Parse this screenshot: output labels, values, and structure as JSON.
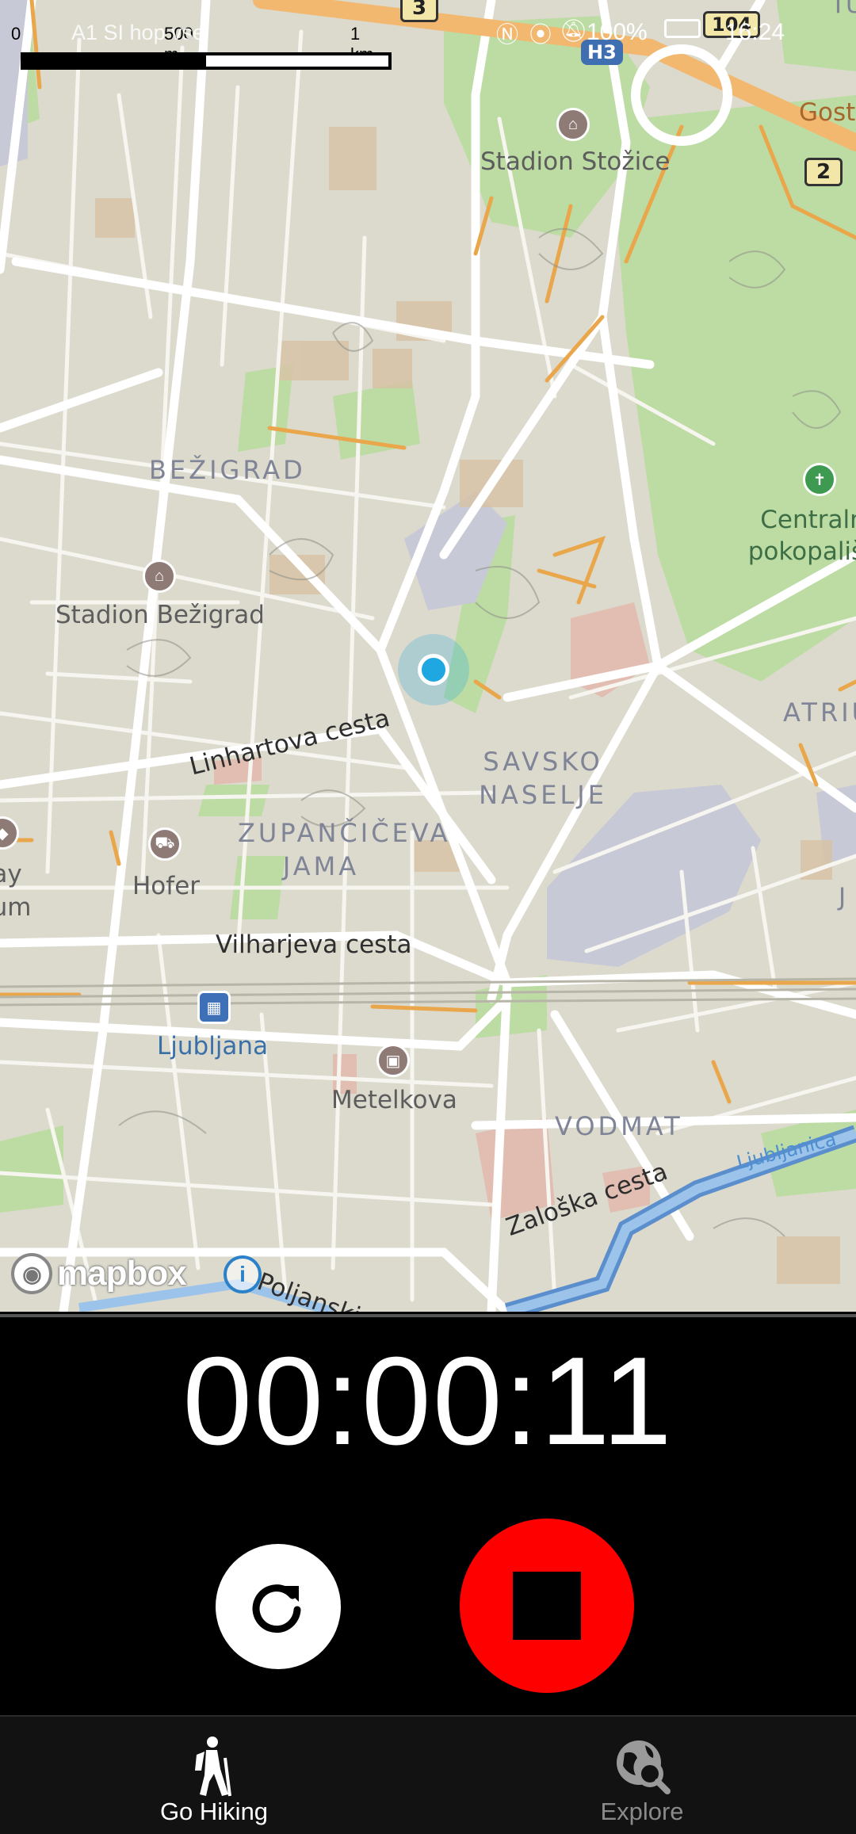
{
  "status_bar": {
    "carrier": "A1 SI hop vse",
    "battery": "100%",
    "time": "16:24"
  },
  "scale_bar": {
    "zero": "0",
    "mid": "500 m",
    "end": "1 km"
  },
  "map": {
    "route_badges": [
      "3",
      "H3",
      "104",
      "2"
    ],
    "districts": [
      "BEŽIGRAD",
      "SAVSKO NASELJE",
      "ZUPANČIČEVA JAMA",
      "VODMAT",
      "ATRIU"
    ],
    "pois": {
      "stadion_stozice": "Stadion Stožice",
      "stadion_bezigrad": "Stadion Bežigrad",
      "centralno_pokopalisce": "Centralno pokopališče",
      "hofer": "Hofer",
      "railway_museum": "Railway Museum",
      "ljubljana_station": "Ljubljana",
      "metelkova": "Metelkova",
      "gosti": "Gosti",
      "ljubljanica": "Ljubljanica",
      "top_right": "TU",
      "right_edge": "J"
    },
    "roads": {
      "linhartova": "Linhartova cesta",
      "vilharjeva": "Vilharjeva cesta",
      "zaloska": "Zaloška cesta",
      "poljanska": "Poljanski"
    },
    "attribution": "mapbox",
    "info_icon": "i"
  },
  "timer": {
    "elapsed": "00:00:11"
  },
  "controls": {
    "reset_icon": "rotate-cw-icon",
    "stop_icon": "stop-icon"
  },
  "nav": {
    "items": [
      {
        "label": "Go Hiking",
        "icon": "hiker-icon",
        "active": true
      },
      {
        "label": "Explore",
        "icon": "globe-search-icon",
        "active": false
      }
    ]
  },
  "colors": {
    "stop": "#ff0000",
    "map_bg": "#dcdacd",
    "park": "#b9d9a0",
    "location_dot": "#1ea7e1",
    "river": "#6fa5d8"
  }
}
